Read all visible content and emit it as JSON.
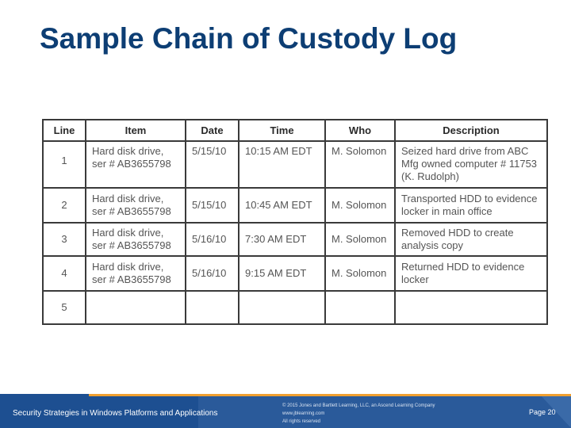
{
  "slide": {
    "title": "Sample Chain of Custody Log"
  },
  "table": {
    "headers": [
      "Line",
      "Item",
      "Date",
      "Time",
      "Who",
      "Description"
    ],
    "rows": [
      {
        "line": "1",
        "item": [
          "Hard disk drive,",
          "ser # AB3655798"
        ],
        "date": "5/15/10",
        "time": "10:15 AM EDT",
        "who": "M. Solomon",
        "description": [
          "Seized hard drive from ABC",
          "Mfg owned computer # 11753",
          "(K. Rudolph)"
        ]
      },
      {
        "line": "2",
        "item": [
          "Hard disk drive,",
          "ser # AB3655798"
        ],
        "date": "5/15/10",
        "time": "10:45 AM EDT",
        "who": "M. Solomon",
        "description": [
          "Transported HDD to evidence",
          "locker in main office"
        ]
      },
      {
        "line": "3",
        "item": [
          "Hard disk drive,",
          "ser # AB3655798"
        ],
        "date": "5/16/10",
        "time": "7:30 AM EDT",
        "who": "M. Solomon",
        "description": [
          "Removed HDD to create",
          "analysis copy"
        ]
      },
      {
        "line": "4",
        "item": [
          "Hard disk drive,",
          "ser # AB3655798"
        ],
        "date": "5/16/10",
        "time": "9:15 AM EDT",
        "who": "M. Solomon",
        "description": [
          "Returned HDD to evidence",
          "locker"
        ]
      },
      {
        "line": "5",
        "item": [],
        "date": "",
        "time": "",
        "who": "",
        "description": []
      }
    ]
  },
  "footer": {
    "course_title": "Security Strategies in Windows Platforms and Applications",
    "copyright_lines": [
      "© 2015 Jones and Bartlett Learning, LLC, an Ascend Learning Company",
      "www.jblearning.com",
      "All rights reserved"
    ],
    "page_label": "Page 20"
  },
  "colors": {
    "title": "#0d3e74",
    "footer_blue": "#1d4f91",
    "footer_accent": "#f0a030"
  }
}
